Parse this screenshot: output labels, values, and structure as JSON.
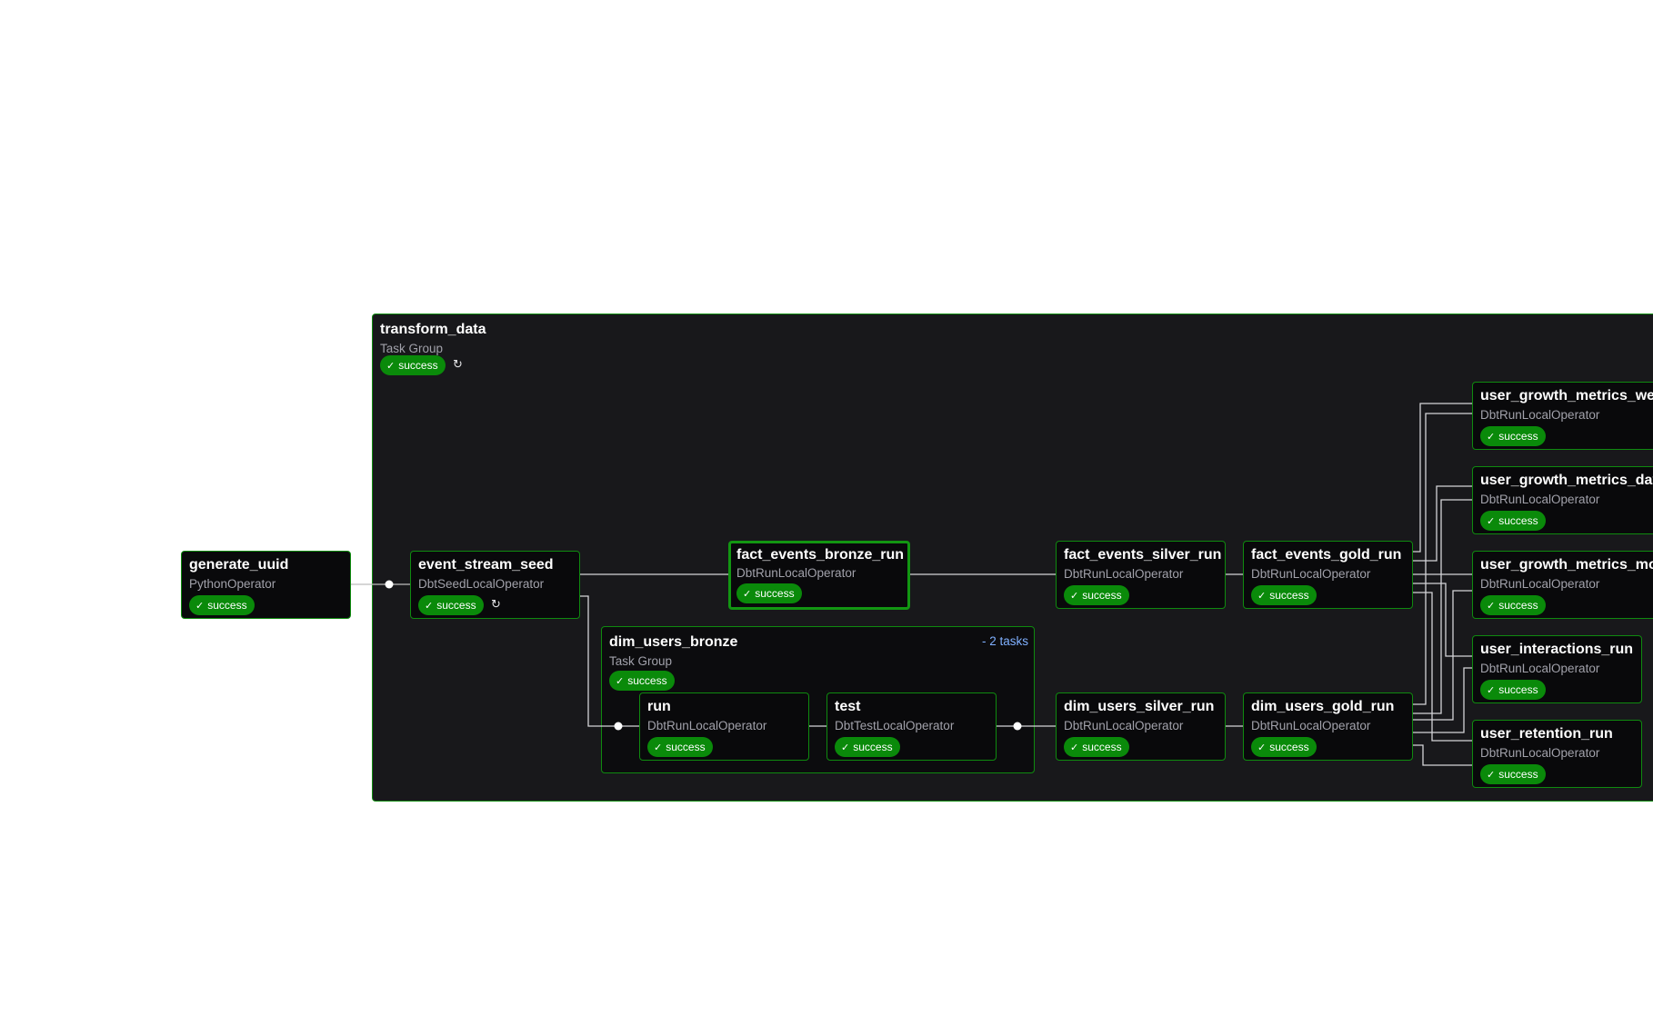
{
  "transform_data": {
    "title": "transform_data",
    "subtitle": "Task Group",
    "status": "success"
  },
  "dim_users_bronze": {
    "title": "dim_users_bronze",
    "subtitle": "Task Group",
    "status": "success",
    "tasks_label": "- 2 tasks"
  },
  "nodes": {
    "generate_uuid": {
      "title": "generate_uuid",
      "operator": "PythonOperator",
      "status": "success"
    },
    "event_stream_seed": {
      "title": "event_stream_seed",
      "operator": "DbtSeedLocalOperator",
      "status": "success"
    },
    "fact_events_bronze_run": {
      "title": "fact_events_bronze_run",
      "operator": "DbtRunLocalOperator",
      "status": "success"
    },
    "run": {
      "title": "run",
      "operator": "DbtRunLocalOperator",
      "status": "success"
    },
    "test": {
      "title": "test",
      "operator": "DbtTestLocalOperator",
      "status": "success"
    },
    "fact_events_silver_run": {
      "title": "fact_events_silver_run",
      "operator": "DbtRunLocalOperator",
      "status": "success"
    },
    "fact_events_gold_run": {
      "title": "fact_events_gold_run",
      "operator": "DbtRunLocalOperator",
      "status": "success"
    },
    "dim_users_silver_run": {
      "title": "dim_users_silver_run",
      "operator": "DbtRunLocalOperator",
      "status": "success"
    },
    "dim_users_gold_run": {
      "title": "dim_users_gold_run",
      "operator": "DbtRunLocalOperator",
      "status": "success"
    },
    "user_growth_metrics_wee": {
      "title": "user_growth_metrics_wee",
      "operator": "DbtRunLocalOperator",
      "status": "success"
    },
    "user_growth_metrics_day": {
      "title": "user_growth_metrics_day",
      "operator": "DbtRunLocalOperator",
      "status": "success"
    },
    "user_growth_metrics_mon": {
      "title": "user_growth_metrics_mon",
      "operator": "DbtRunLocalOperator",
      "status": "success"
    },
    "user_interactions_run": {
      "title": "user_interactions_run",
      "operator": "DbtRunLocalOperator",
      "status": "success"
    },
    "user_retention_run": {
      "title": "user_retention_run",
      "operator": "DbtRunLocalOperator",
      "status": "success"
    }
  },
  "colors": {
    "success": "#0a8a0a",
    "border": "#0f8a0f",
    "edge": "#d4d4d8",
    "background": "#ffffff",
    "group_bg": "#18181b",
    "node_bg": "#09090b"
  },
  "icons": {
    "status": "check-icon",
    "retry": "refresh-icon"
  }
}
